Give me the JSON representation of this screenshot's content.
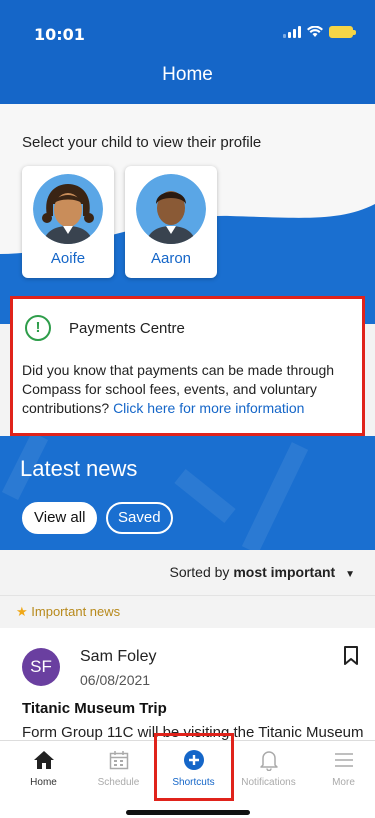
{
  "status_bar": {
    "time": "10:01"
  },
  "header": {
    "title": "Home"
  },
  "children": {
    "prompt": "Select your child to view their profile",
    "items": [
      {
        "name": "Aoife"
      },
      {
        "name": "Aaron"
      }
    ]
  },
  "payments": {
    "icon_symbol": "!",
    "title": "Payments Centre",
    "body": "Did you know that payments can be made through Compass for school fees, events, and voluntary contributions?",
    "link": "Click here for more information"
  },
  "news": {
    "title": "Latest news",
    "view_all": "View all",
    "saved": "Saved",
    "sort_prefix": "Sorted by",
    "sort_value": "most important",
    "important_label": "Important news",
    "item": {
      "author_initials": "SF",
      "author": "Sam Foley",
      "date": "06/08/2021",
      "title": "Titanic Museum Trip",
      "body": "Form Group 11C will be visiting the Titanic Museum"
    }
  },
  "nav": {
    "items": [
      {
        "label": "Home",
        "icon": "home-icon"
      },
      {
        "label": "Schedule",
        "icon": "calendar-icon"
      },
      {
        "label": "Shortcuts",
        "icon": "plus-circle-icon"
      },
      {
        "label": "Notifications",
        "icon": "bell-icon"
      },
      {
        "label": "More",
        "icon": "menu-icon"
      }
    ]
  },
  "colors": {
    "primary": "#1566c8",
    "highlight": "#e0231b",
    "success": "#2e9d4a",
    "important": "#b88a1c"
  }
}
